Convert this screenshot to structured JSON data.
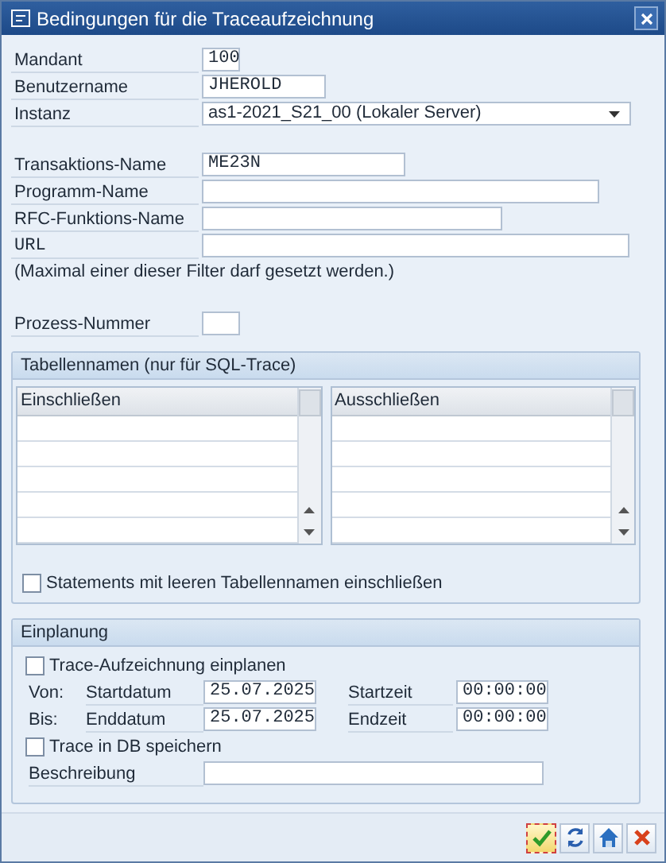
{
  "window": {
    "title": "Bedingungen für die Traceaufzeichnung"
  },
  "fields": [
    {
      "kind": "text",
      "label": "Mandant",
      "value": "100",
      "mono_label": false
    },
    {
      "kind": "text",
      "label": "Benutzername",
      "value": "JHEROLD",
      "mono_label": false
    },
    {
      "kind": "dropdown",
      "label": "Instanz",
      "value": "as1-2021_S21_00 (Lokaler Server)",
      "mono_label": false
    },
    {
      "kind": "gap"
    },
    {
      "kind": "text",
      "label": "Transaktions-Name",
      "value": "ME23N",
      "mono_label": false
    },
    {
      "kind": "text",
      "label": "Programm-Name",
      "mono_label": false
    },
    {
      "kind": "text",
      "label": "RFC-Funktions-Name",
      "mono_label": false
    },
    {
      "kind": "text",
      "label": "URL",
      "mono_label": true
    },
    {
      "kind": "note",
      "label": "(Maximal einer dieser Filter darf gesetzt werden.)"
    },
    {
      "kind": "gap"
    },
    {
      "kind": "text",
      "label": "Prozess-Nummer",
      "mono_label": false
    }
  ],
  "table_group": {
    "title": "Tabellennamen (nur für SQL-Trace)",
    "tables": [
      {
        "header": "Einschließen"
      },
      {
        "header": "Ausschließen"
      }
    ],
    "checkbox": {
      "label": "Statements mit leeren Tabellennamen einschließen",
      "checked": false
    }
  },
  "scheduling": {
    "title": "Einplanung",
    "plan_checkbox": {
      "label": "Trace-Aufzeichnung einplanen",
      "checked": false
    },
    "rows": [
      {
        "prefix": "Von:",
        "date_label": "Startdatum",
        "date": "25.07.2025",
        "time_label": "Startzeit",
        "time": "00:00:00"
      },
      {
        "prefix": "Bis:",
        "date_label": "Enddatum",
        "date": "25.07.2025",
        "time_label": "Endzeit",
        "time": "00:00:00"
      }
    ],
    "db_checkbox": {
      "label": "Trace in DB speichern",
      "checked": false
    },
    "description_label": "Beschreibung"
  },
  "buttons": [
    {
      "kind": "confirm",
      "focused": true
    },
    {
      "kind": "refresh",
      "focused": false
    },
    {
      "kind": "save",
      "focused": false
    },
    {
      "kind": "cancel",
      "focused": false
    }
  ]
}
